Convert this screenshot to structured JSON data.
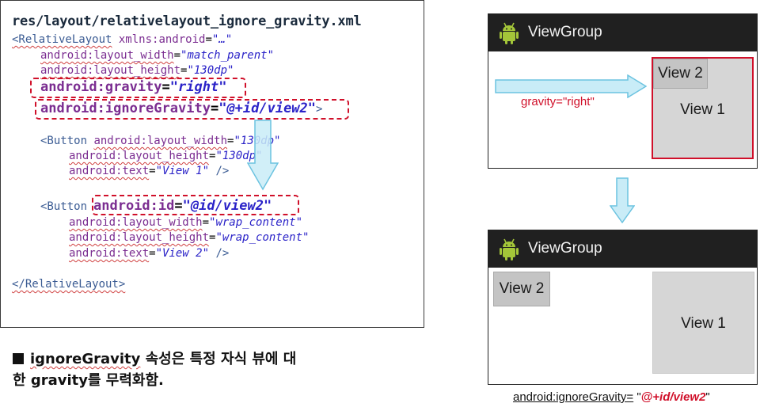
{
  "code": {
    "file_path": "res/layout/relativelayout_ignore_gravity.xml",
    "lines": {
      "l1_tag": "<RelativeLayout",
      "l1_attr": "xmlns:android",
      "l1_val": "\"…\"",
      "l2_attr": "android:layout_width",
      "l2_val": "\"match_parent\"",
      "l3_attr": "android:layout_height",
      "l3_val": "\"130dp\"",
      "l4_attr": "android:gravity",
      "l4_val": "\"right\"",
      "l5_attr": "android:ignoreGravity",
      "l5_val": "\"@+id/view2\"",
      "l5_end": ">",
      "b1_tag": "<Button",
      "b1_attr1": "android:layout_width",
      "b1_val1": "\"130dp\"",
      "b1_attr2": "android:layout_height",
      "b1_val2": "\"130dp\"",
      "b1_attr3": "android:text",
      "b1_val3": "\"View 1\"",
      "b1_end": "/>",
      "b2_tag": "<Button",
      "b2_attr0": "android:id",
      "b2_val0": "\"@id/view2\"",
      "b2_attr1": "android:layout_width",
      "b2_val1": "\"wrap_content\"",
      "b2_attr2": "android:layout_height",
      "b2_val2": "\"wrap_content\"",
      "b2_attr3": "android:text",
      "b2_val3": "\"View 2\"",
      "b2_end": "/>",
      "close_tag": "</RelativeLayout>",
      "eq": "="
    }
  },
  "caption": {
    "keyword": "ignoreGravity",
    "line1_rest": " 속성은 특정 자식 뷰에 대",
    "line2": "한 gravity를 무력화함."
  },
  "phone_top": {
    "title": "ViewGroup",
    "view2_label": "View 2",
    "view1_label": "View 1",
    "gravity_label": "gravity=\"right\""
  },
  "phone_bottom": {
    "title": "ViewGroup",
    "view2_label": "View 2",
    "view1_label": "View 1"
  },
  "bottom_label": {
    "prefix": "android:ignoreGravity=",
    "q1": " \"",
    "value": "@+id/view2",
    "q2": "\""
  },
  "colors": {
    "highlight_red": "#d0102a",
    "arrow_fill": "#c9ecf7",
    "arrow_stroke": "#6cc3e0",
    "actionbar": "#202020"
  }
}
